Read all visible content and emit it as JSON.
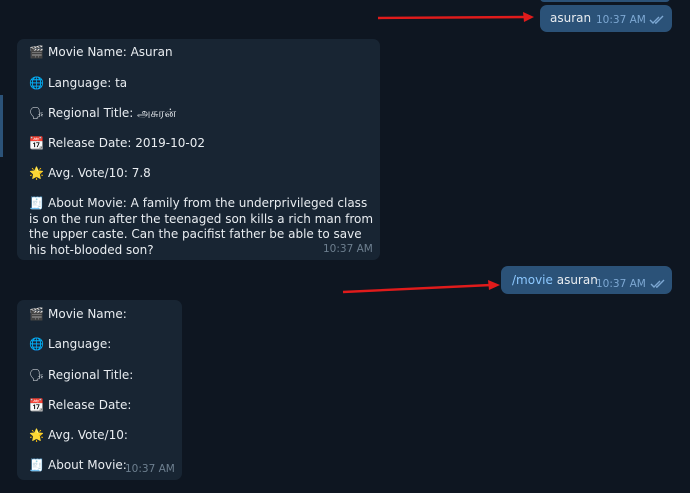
{
  "messages": {
    "first_out": {
      "text": "asuran",
      "time": "10:37 AM"
    },
    "first_reply": {
      "movie_name": "Movie Name: Asuran",
      "language": "Language: ta",
      "regional_title": "Regional Title: அசுரன்",
      "release_date": "Release Date: 2019-10-02",
      "avg_vote": "Avg. Vote/10: 7.8",
      "about": "About Movie: A family from the underprivileged class is on the run after the teenaged son kills a rich man from the upper caste. Can the pacifist father be able to save his hot-blooded son?",
      "time": "10:37 AM"
    },
    "second_out": {
      "command": "/movie",
      "arg": " asuran",
      "time": "10:37 AM"
    },
    "second_reply": {
      "movie_name": "Movie Name:",
      "language": "Language:",
      "regional_title": "Regional Title:",
      "release_date": "Release Date:",
      "avg_vote": "Avg. Vote/10:",
      "about": "About Movie:",
      "time": "10:37 AM"
    }
  },
  "icons": {
    "movie": "clapperboard-icon",
    "language": "globe-icon",
    "regional": "speaking-head-icon",
    "date": "calendar-icon",
    "vote": "star-icon",
    "about": "memo-icon",
    "read": "double-check-icon"
  },
  "colors": {
    "background": "#0e1621",
    "incoming_bubble": "#182533",
    "outgoing_bubble": "#2b5278",
    "arrow": "#e01b1b",
    "command": "#8cc8ff"
  }
}
